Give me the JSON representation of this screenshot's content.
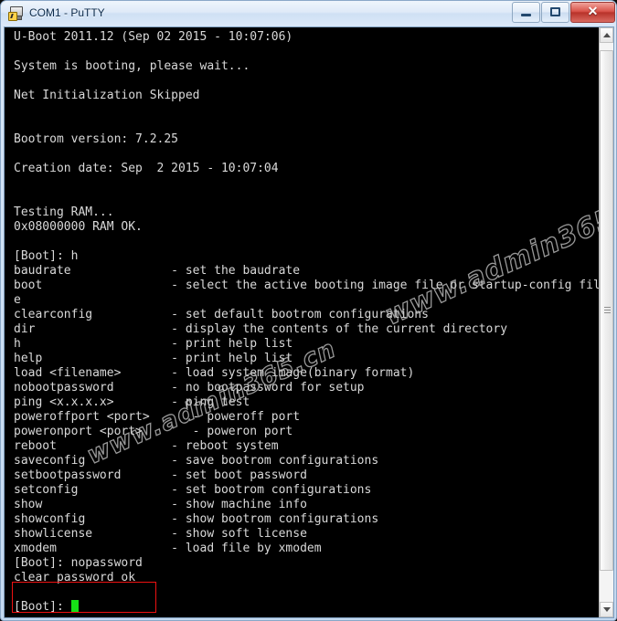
{
  "window": {
    "title": "COM1 - PuTTY",
    "icon": "putty-computer-icon",
    "buttons": {
      "minimize": "—",
      "maximize": "□",
      "close": "✕"
    }
  },
  "terminal": {
    "foreground_color": "#d9d9d9",
    "background_color": "#000000",
    "cursor_color": "#16e016",
    "lines": [
      "U-Boot 2011.12 (Sep 02 2015 - 10:07:06)",
      "",
      "System is booting, please wait...",
      "",
      "Net Initialization Skipped",
      "",
      "",
      "Bootrom version: 7.2.25",
      "",
      "Creation date: Sep  2 2015 - 10:07:04",
      "",
      "",
      "Testing RAM...",
      "0x08000000 RAM OK.",
      "",
      "[Boot]: h",
      "baudrate              - set the baudrate",
      "boot                  - select the active booting image file or startup-config fil",
      "e",
      "clearconfig           - set default bootrom configurations",
      "dir                   - display the contents of the current directory",
      "h                     - print help list",
      "help                  - print help list",
      "load <filename>       - load system image(binary format)",
      "nobootpassword        - no bootpassword for setup",
      "ping <x.x.x.x>        - ping test",
      "poweroffport <port>      - poweroff port",
      "poweronport <port>       - poweron port",
      "reboot                - reboot system",
      "saveconfig            - save bootrom configurations",
      "setbootpassword       - set boot password",
      "setconfig             - set bootrom configurations",
      "show                  - show machine info",
      "showconfig            - show bootrom configurations",
      "showlicense           - show soft license",
      "xmodem                - load file by xmodem",
      "[Boot]: nopassword",
      "clear password ok",
      ""
    ],
    "prompt": "[Boot]: "
  },
  "annotation": {
    "box_color": "#ee1111",
    "highlighted_command": "[Boot]: nopassword",
    "highlighted_result": "clear password ok"
  },
  "watermark": {
    "text": "www.admin365.cn"
  },
  "scrollbar": {
    "up_arrow": "scroll-up",
    "down_arrow": "scroll-down",
    "position": "bottom"
  }
}
